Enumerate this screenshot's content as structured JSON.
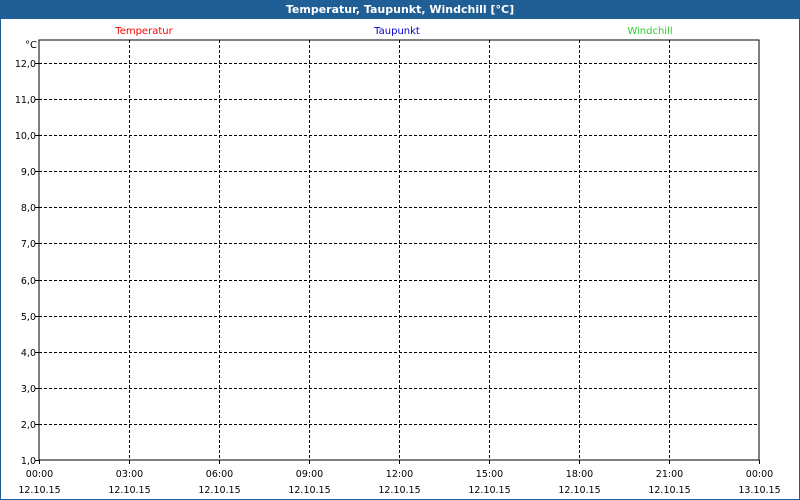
{
  "window": {
    "title": "Temperatur, Taupunkt, Windchill [°C]"
  },
  "chart_data": {
    "type": "line",
    "title": "Temperatur, Taupunkt, Windchill [°C]",
    "ylabel": "°C",
    "ylim": [
      1.0,
      12.0
    ],
    "y_ticks": [
      "1,0",
      "2,0",
      "3,0",
      "4,0",
      "5,0",
      "6,0",
      "7,0",
      "8,0",
      "9,0",
      "10,0",
      "11,0",
      "12,0"
    ],
    "x_ticks": [
      {
        "time": "00:00",
        "date": "12.10.15"
      },
      {
        "time": "03:00",
        "date": "12.10.15"
      },
      {
        "time": "06:00",
        "date": "12.10.15"
      },
      {
        "time": "09:00",
        "date": "12.10.15"
      },
      {
        "time": "12:00",
        "date": "12.10.15"
      },
      {
        "time": "15:00",
        "date": "12.10.15"
      },
      {
        "time": "18:00",
        "date": "12.10.15"
      },
      {
        "time": "21:00",
        "date": "12.10.15"
      },
      {
        "time": "00:00",
        "date": "13.10.15"
      }
    ],
    "series": [
      {
        "name": "Temperatur",
        "color": "#ff0000",
        "values": []
      },
      {
        "name": "Taupunkt",
        "color": "#0000cc",
        "values": []
      },
      {
        "name": "Windchill",
        "color": "#33cc33",
        "values": []
      }
    ],
    "grid": true,
    "legend": "top"
  }
}
